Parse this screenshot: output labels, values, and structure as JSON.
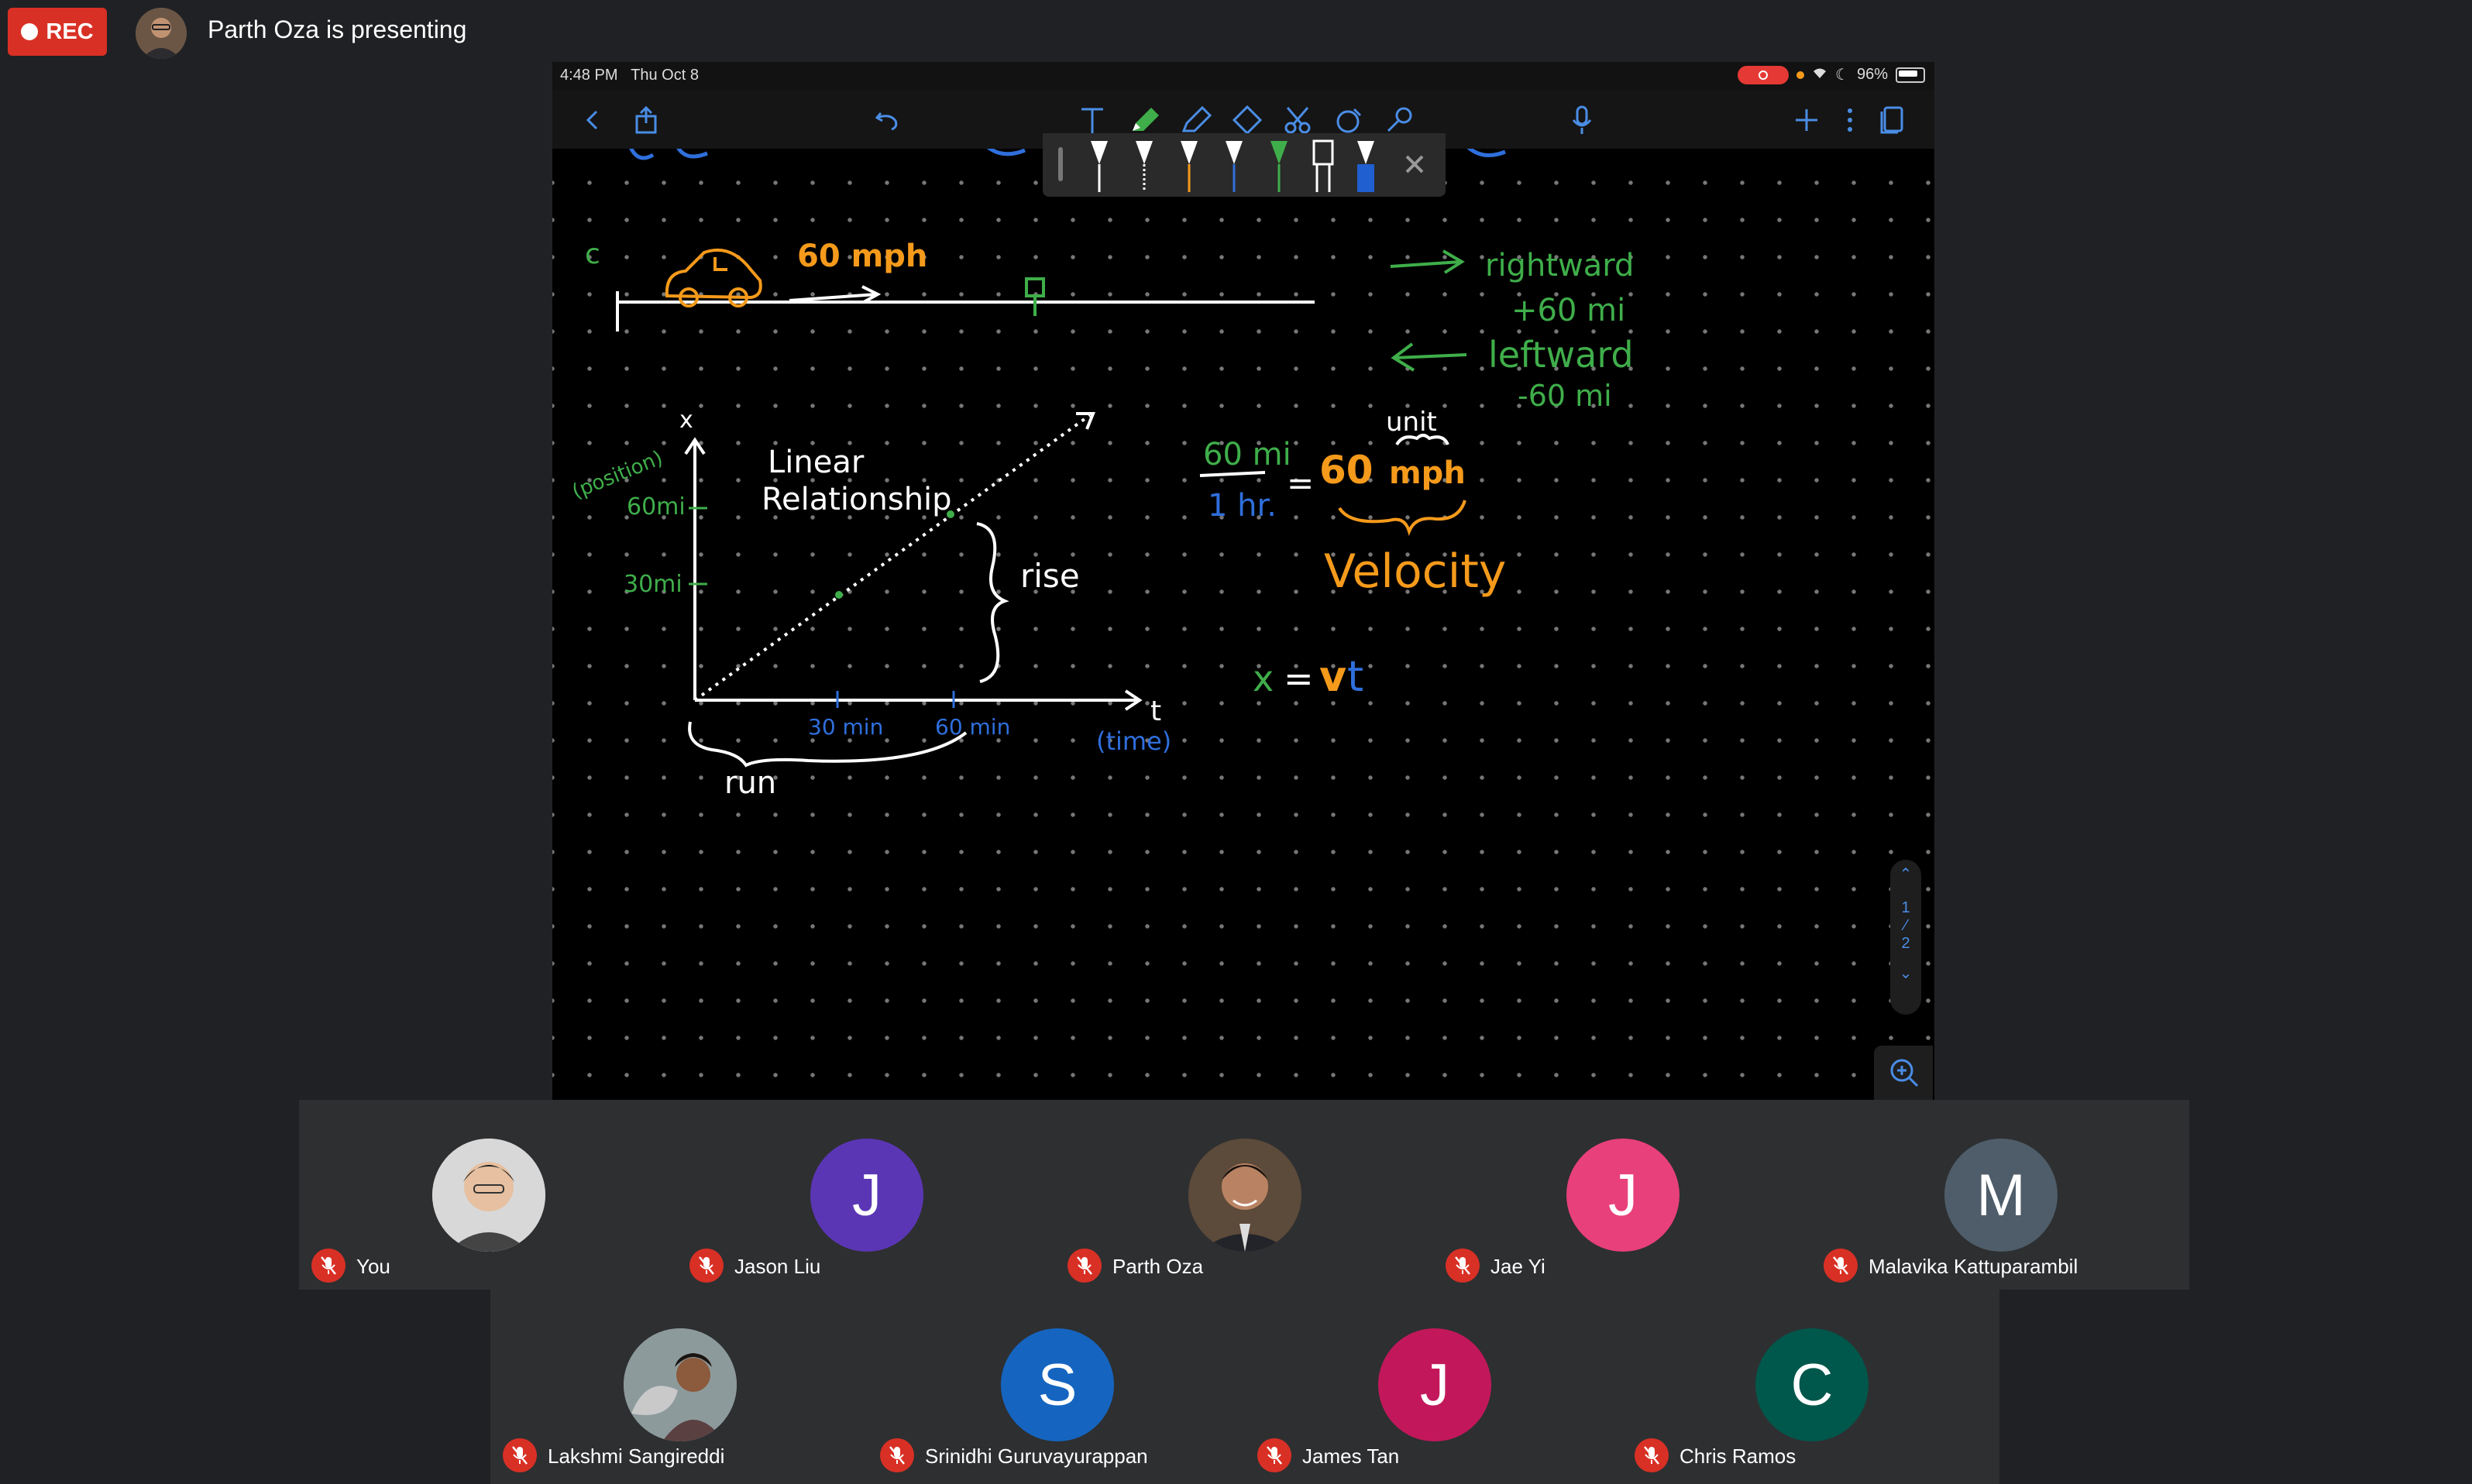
{
  "meeting": {
    "rec_label": "REC",
    "presenting_text": "Parth Oza is presenting"
  },
  "ipad": {
    "time": "4:48 PM",
    "date": "Thu Oct 8",
    "battery": "96%"
  },
  "page_nav": {
    "current": "1",
    "total": "2"
  },
  "whiteboard": {
    "speed_label": "60 mph",
    "start_mark": "c",
    "rightward": "rightward",
    "plus_60": "+60 mi",
    "leftward": "leftward",
    "minus_60": "-60 mi",
    "x_axis_letter": "x",
    "position_label": "(position)",
    "y_tick_60": "60mi",
    "y_tick_30": "30mi",
    "linear_line1": "Linear",
    "linear_line2": "Relationship",
    "rise": "rise",
    "t_axis_letter": "t",
    "time_label": "(time)",
    "x_tick_30": "30 min",
    "x_tick_60": "60 min",
    "run": "run",
    "unit": "unit",
    "frac_num": "60 mi",
    "frac_den": "1 hr.",
    "equals": "=",
    "result_num": "60",
    "result_unit": "mph",
    "velocity": "Velocity",
    "eq_x": "x",
    "eq_equals": "=",
    "eq_v": "v",
    "eq_t": "t"
  },
  "colors": {
    "green": "#3fae4a",
    "orange": "#f59a1b",
    "blue": "#2f6fdc",
    "red": "#d93025"
  },
  "participants_row1": [
    {
      "name": "You",
      "initial": "",
      "color": "#7a8a9a",
      "photo": true
    },
    {
      "name": "Jason Liu",
      "initial": "J",
      "color": "#5b36b4",
      "photo": false
    },
    {
      "name": "Parth Oza",
      "initial": "",
      "color": "#4a3b2e",
      "photo": true
    },
    {
      "name": "Jae Yi",
      "initial": "J",
      "color": "#e8407a",
      "photo": false
    },
    {
      "name": "Malavika Kattuparambil",
      "initial": "M",
      "color": "#4e5d69",
      "photo": false
    }
  ],
  "participants_row2": [
    {
      "name": "Lakshmi Sangireddi",
      "initial": "",
      "color": "#7c8a8f",
      "photo": true
    },
    {
      "name": "Srinidhi Guruvayurappan",
      "initial": "S",
      "color": "#1565c0",
      "photo": false
    },
    {
      "name": "James Tan",
      "initial": "J",
      "color": "#c2185b",
      "photo": false
    },
    {
      "name": "Chris Ramos",
      "initial": "C",
      "color": "#00574b",
      "photo": false
    }
  ]
}
